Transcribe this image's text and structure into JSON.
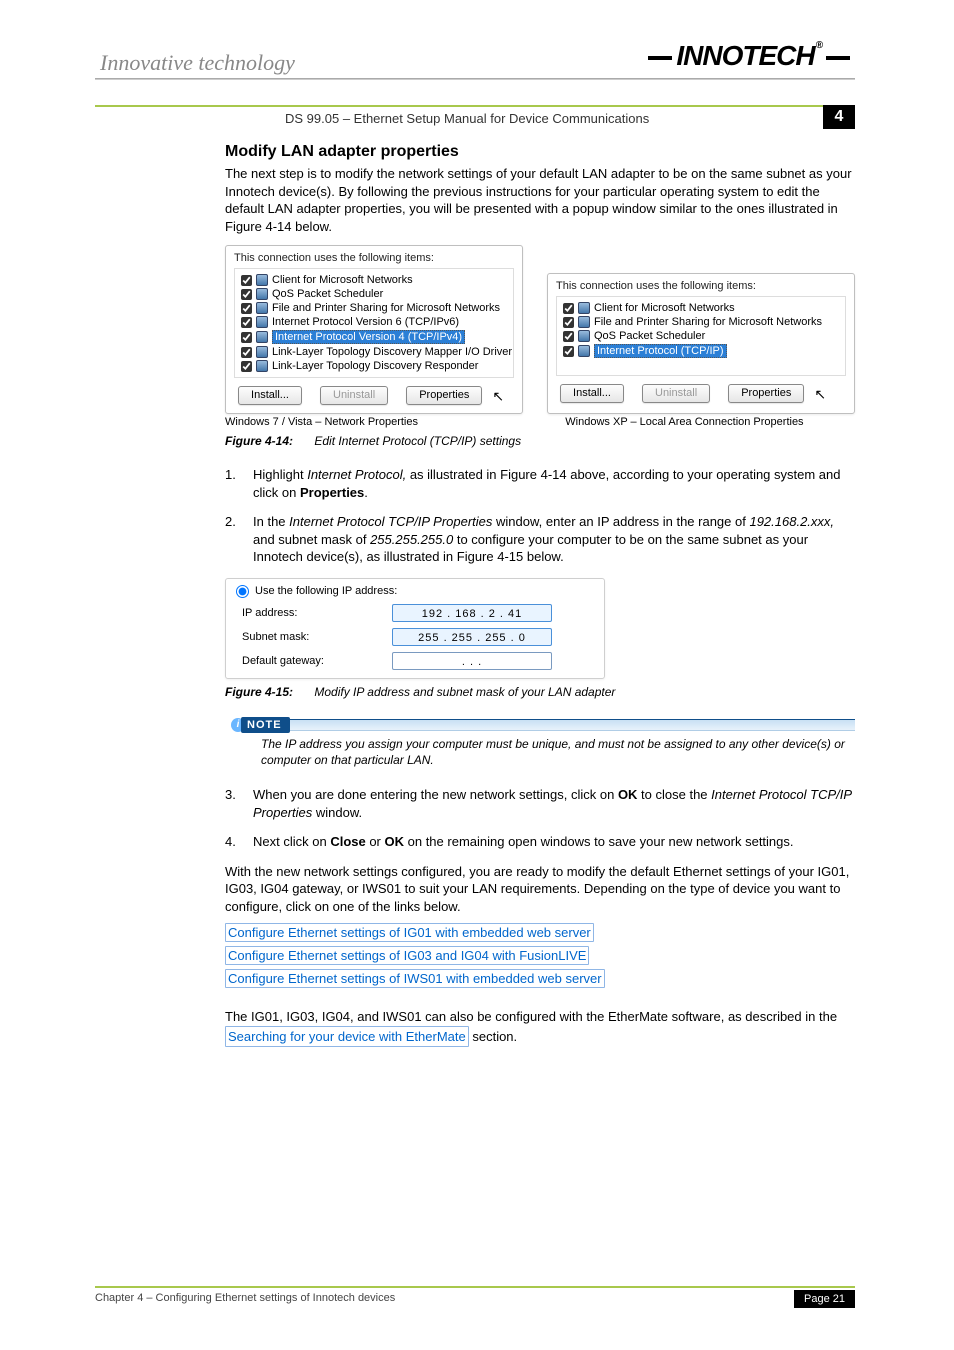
{
  "header": {
    "tagline": "Innovative technology",
    "logo_text": "INNOTECH"
  },
  "titlebar": {
    "doc_title": "DS 99.05 – Ethernet Setup Manual for Device Communications",
    "chapter_number": "4"
  },
  "section": {
    "heading": "Modify LAN adapter properties",
    "intro": "The next step is to modify the network settings of your default LAN adapter to be on the same subnet as your Innotech device(s). By following the previous instructions for your particular operating system to edit the default LAN adapter properties, you will be presented with a popup window similar to the ones illustrated in Figure 4-14 below."
  },
  "fig414": {
    "left": {
      "conn_label": "This connection uses the following items:",
      "items": [
        "Client for Microsoft Networks",
        "QoS Packet Scheduler",
        "File and Printer Sharing for Microsoft Networks",
        "Internet Protocol Version 6 (TCP/IPv6)",
        "Internet Protocol Version 4 (TCP/IPv4)",
        "Link-Layer Topology Discovery Mapper I/O Driver",
        "Link-Layer Topology Discovery Responder"
      ],
      "buttons": {
        "install": "Install...",
        "uninstall": "Uninstall",
        "properties": "Properties"
      },
      "caption": "Windows 7  / Vista – Network Properties"
    },
    "right": {
      "conn_label": "This connection uses the following items:",
      "items": [
        "Client for Microsoft Networks",
        "File and Printer Sharing for Microsoft Networks",
        "QoS Packet Scheduler",
        "Internet Protocol (TCP/IP)"
      ],
      "buttons": {
        "install": "Install...",
        "uninstall": "Uninstall",
        "properties": "Properties"
      },
      "caption": "Windows XP – Local Area Connection Properties"
    },
    "figure_label": "Figure 4-14:",
    "figure_text": "Edit Internet Protocol (TCP/IP) settings"
  },
  "steps12": {
    "s1_a": "Highlight ",
    "s1_b": "Internet Protocol,",
    "s1_c": " as illustrated in Figure 4-14 above, according to your operating system and click on ",
    "s1_d": "Properties",
    "s1_e": ".",
    "s2_a": "In the ",
    "s2_b": "Internet Protocol TCP/IP Properties",
    "s2_c": " window, enter an IP address in the range of ",
    "s2_d": "192.168.2.xxx,",
    "s2_e": " and subnet mask of ",
    "s2_f": "255.255.255.0",
    "s2_g": " to configure your computer to be on the same subnet as your Innotech device(s), as illustrated in Figure 4-15 below."
  },
  "ipbox": {
    "radio_label": "Use the following IP address:",
    "rows": {
      "ip_label": "IP address:",
      "ip_value": "192 . 168 .  2  .  41",
      "mask_label": "Subnet mask:",
      "mask_value": "255 . 255 . 255 .  0",
      "gw_label": "Default gateway:",
      "gw_value": ".        .        ."
    }
  },
  "fig415": {
    "figure_label": "Figure 4-15:",
    "figure_text": "Modify IP address and subnet mask of your LAN adapter"
  },
  "note": {
    "label": "NOTE",
    "text": "The IP address you assign your computer must be unique, and must not be assigned to any other device(s) or computer on that particular LAN."
  },
  "steps34": {
    "s3_a": "When you are done entering the new network settings, click on ",
    "s3_b": "OK",
    "s3_c": " to close the ",
    "s3_d": "Internet Protocol TCP/IP Properties",
    "s3_e": " window.",
    "s4_a": "Next click on ",
    "s4_b": "Close",
    "s4_c": " or ",
    "s4_d": "OK",
    "s4_e": " on the remaining open windows to save your new network settings."
  },
  "closing_para": "With the new network settings configured, you are ready to modify the default Ethernet settings of your IG01, IG03, IG04 gateway, or IWS01 to suit your LAN requirements. Depending on the type of device you want to configure, click on one of the links below.",
  "links": {
    "l1": "Configure Ethernet settings of IG01 with embedded web server",
    "l2": "Configure Ethernet settings of IG03 and IG04 with FusionLIVE",
    "l3": "Configure Ethernet settings of IWS01 with embedded web server"
  },
  "final_para": {
    "a": "The IG01, IG03, IG04, and IWS01 can also be configured with the EtherMate software, as described in the ",
    "link": "Searching for your device with EtherMate",
    "b": " section."
  },
  "footer": {
    "chapter_text": "Chapter 4 – Configuring Ethernet settings of Innotech devices",
    "page_label": "Page 21"
  }
}
